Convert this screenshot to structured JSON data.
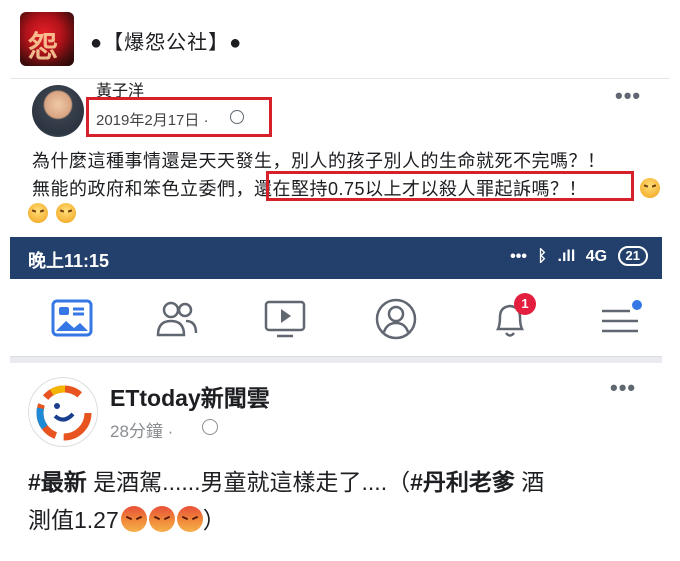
{
  "header": {
    "page_name": "●【爆怨公社】●",
    "avatar_glyph": "怨"
  },
  "post1": {
    "author": "黃子洋",
    "date": "2019年2月17日 ·",
    "text_line1": "為什麼這種事情還是天天發生，別人的孩子別人的生命就死不完嗎？！",
    "text_line2_prefix": "無能的政府和笨色立委們，",
    "text_line2_highlight": "還在堅持0.75以上才以殺人罪起訴嗎？！",
    "more": "•••"
  },
  "status_bar": {
    "time": "晚上11:15",
    "dots": "•••",
    "bluetooth": "ᛒ",
    "signal": ".ıll",
    "network": "4G",
    "battery": "21"
  },
  "nav": {
    "notification_count": "1",
    "accent_color": "#3578e5"
  },
  "post2": {
    "page_name": "ETtoday新聞雲",
    "time": "28分鐘 ·",
    "more": "•••",
    "tag1": "#最新",
    "text1": " 是酒駕......男童就這樣走了....（",
    "tag2": "#丹利老爹",
    "text2": " 酒",
    "line2_text": "測值1.27",
    "line2_close": "）"
  },
  "colors": {
    "highlight_box": "#d6202a",
    "status_bar": "#22406b",
    "badge": "#e41e3f"
  }
}
